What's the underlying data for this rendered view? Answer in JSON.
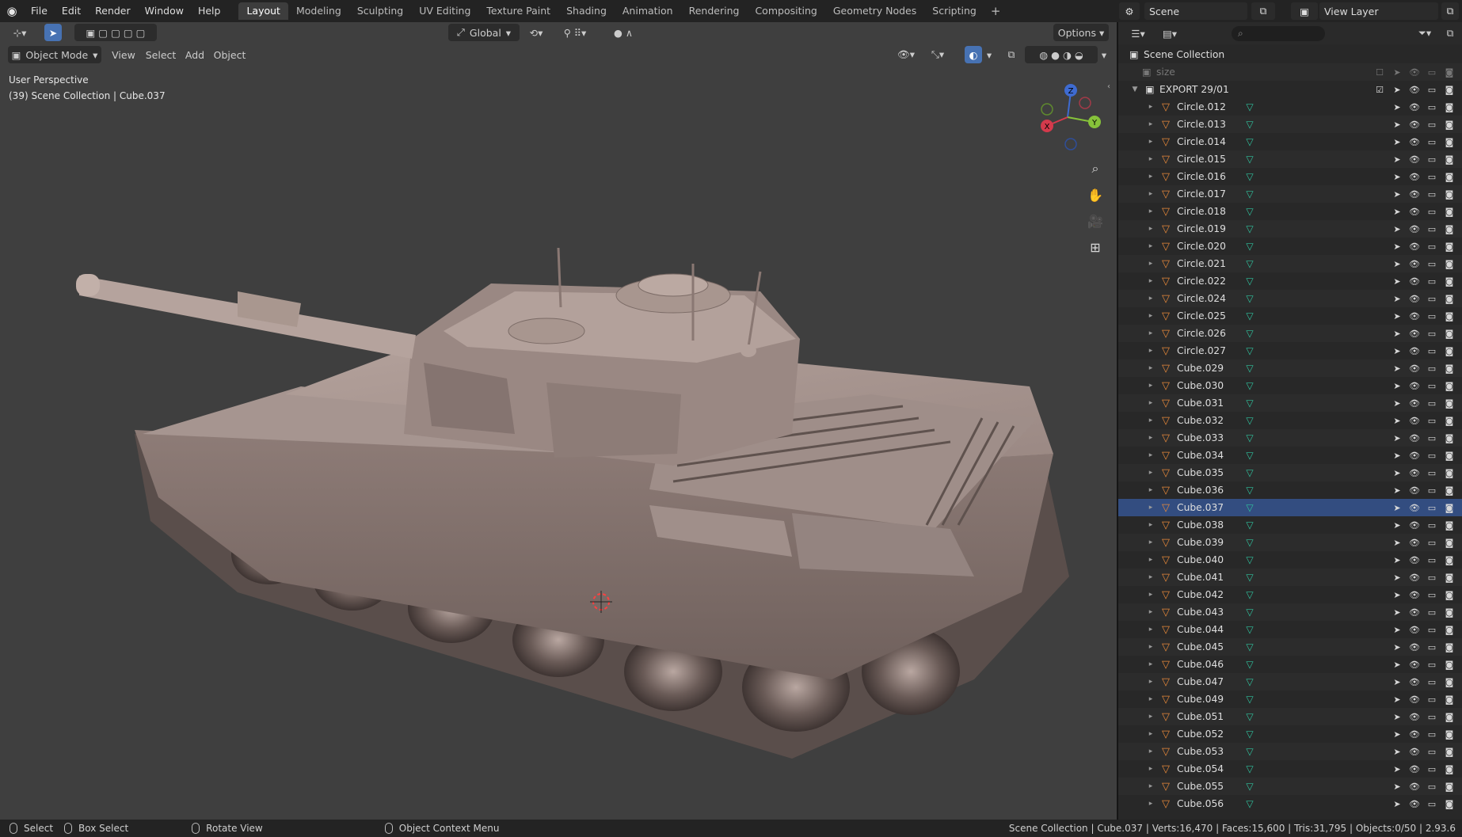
{
  "menu": [
    "File",
    "Edit",
    "Render",
    "Window",
    "Help"
  ],
  "workspaces": [
    "Layout",
    "Modeling",
    "Sculpting",
    "UV Editing",
    "Texture Paint",
    "Shading",
    "Animation",
    "Rendering",
    "Compositing",
    "Geometry Nodes",
    "Scripting"
  ],
  "active_workspace": "Layout",
  "scene_name": "Scene",
  "view_layer": "View Layer",
  "viewport": {
    "mode": "Object Mode",
    "menus": [
      "View",
      "Select",
      "Add",
      "Object"
    ],
    "transform_orientation": "Global",
    "options_label": "Options",
    "perspective_label": "User Perspective",
    "collection_info": "(39) Scene Collection | Cube.037",
    "gizmo": {
      "x": "X",
      "y": "Y",
      "z": "Z"
    }
  },
  "outliner": {
    "root": "Scene Collection",
    "size_item": "size",
    "collection": "EXPORT 29/01",
    "objects": [
      "Circle.012",
      "Circle.013",
      "Circle.014",
      "Circle.015",
      "Circle.016",
      "Circle.017",
      "Circle.018",
      "Circle.019",
      "Circle.020",
      "Circle.021",
      "Circle.022",
      "Circle.024",
      "Circle.025",
      "Circle.026",
      "Circle.027",
      "Cube.029",
      "Cube.030",
      "Cube.031",
      "Cube.032",
      "Cube.033",
      "Cube.034",
      "Cube.035",
      "Cube.036",
      "Cube.037",
      "Cube.038",
      "Cube.039",
      "Cube.040",
      "Cube.041",
      "Cube.042",
      "Cube.043",
      "Cube.044",
      "Cube.045",
      "Cube.046",
      "Cube.047",
      "Cube.049",
      "Cube.051",
      "Cube.052",
      "Cube.053",
      "Cube.054",
      "Cube.055",
      "Cube.056"
    ],
    "active_object": "Cube.037"
  },
  "statusbar": {
    "select": "Select",
    "box_select": "Box Select",
    "rotate_view": "Rotate View",
    "context_menu": "Object Context Menu",
    "stats": "Scene Collection | Cube.037 | Verts:16,470 | Faces:15,600 | Tris:31,795 | Objects:0/50 | 2.93.6"
  },
  "colors": {
    "accent": "#4772b3",
    "object_icon": "#e7893a",
    "mesh_icon": "#2fc29e",
    "viewport_bg": "#3f3f3f",
    "model": "#8e7b76"
  }
}
